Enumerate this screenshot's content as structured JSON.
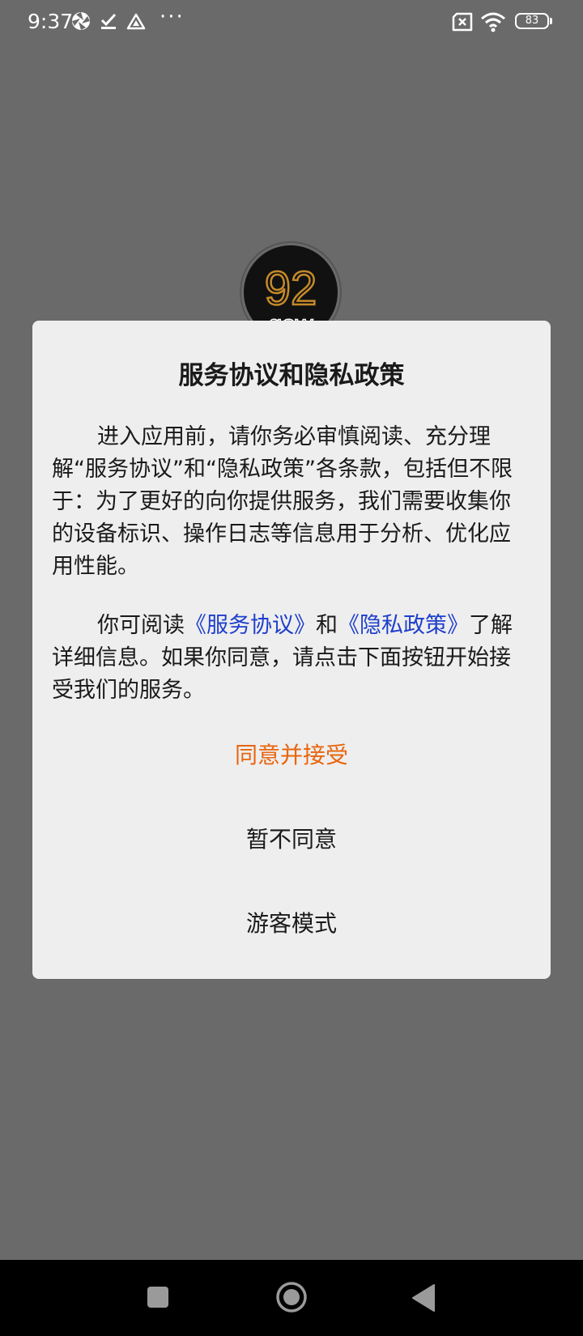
{
  "status_bar": {
    "time": "9:37",
    "battery": "83",
    "icons": [
      "app-aperture-icon",
      "task-check-icon",
      "drive-triangle-icon",
      "more-dots-icon",
      "no-sim-icon",
      "wifi-icon",
      "battery-icon"
    ],
    "more": "···"
  },
  "logo": {
    "text": "92",
    "sub_text": "gow",
    "accent_color": "#c48a2a"
  },
  "dialog": {
    "title": "服务协议和隐私政策",
    "paragraph1": "进入应用前，请你务必审慎阅读、充分理解“服务协议”和“隐私政策”各条款，包括但不限于：为了更好的向你提供服务，我们需要收集你的设备标识、操作日志等信息用于分析、优化应用性能。",
    "paragraph2_prefix": "你可阅读",
    "link_service": "《服务协议》",
    "paragraph2_and": "和",
    "link_privacy": "《隐私政策》",
    "paragraph2_suffix": "了解详细信息。如果你同意，请点击下面按钮开始接受我们的服务。",
    "agree_label": "同意并接受",
    "disagree_label": "暂不同意",
    "guest_label": "游客模式",
    "link_color": "#1e3fcc",
    "agree_color": "#e8650f"
  },
  "nav_bar": {
    "icons": [
      "recents-square-icon",
      "home-circle-icon",
      "back-triangle-icon"
    ]
  }
}
